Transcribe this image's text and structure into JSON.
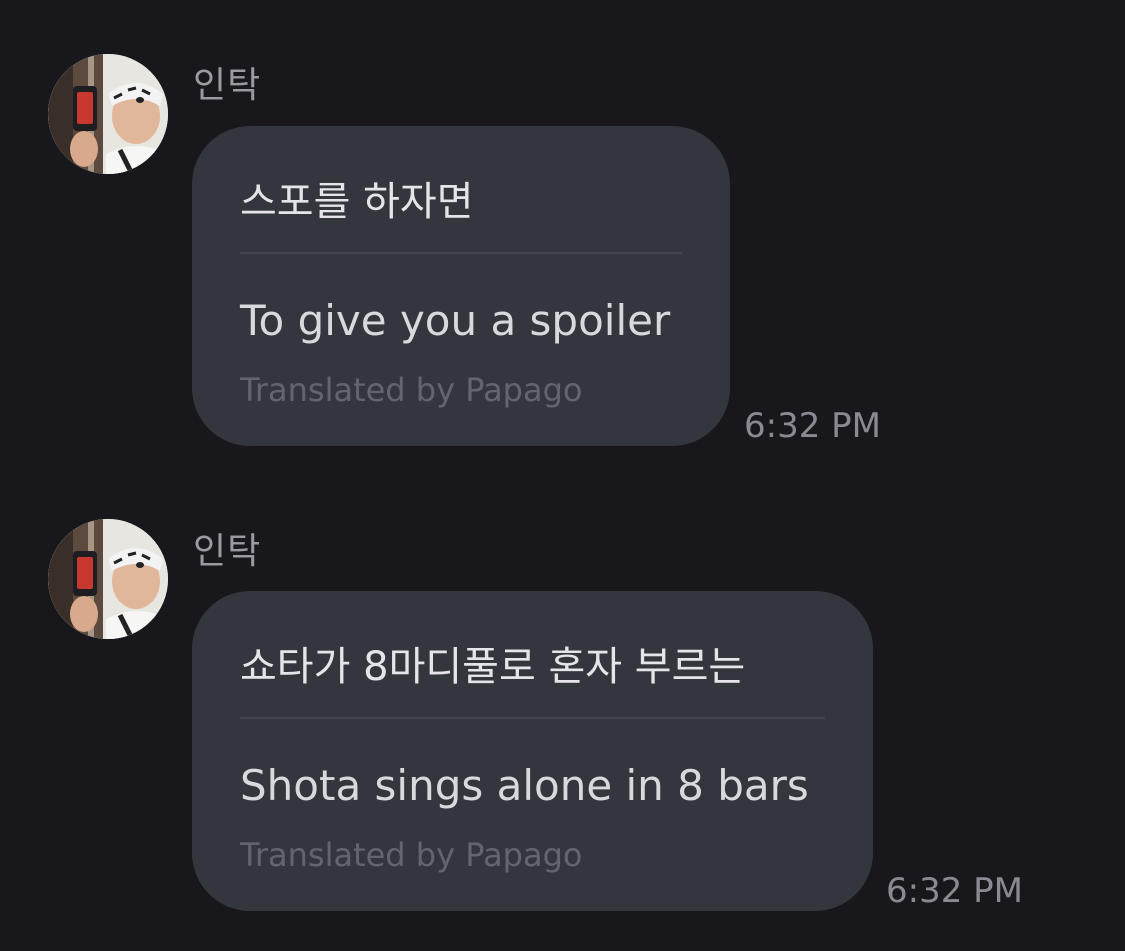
{
  "messages": [
    {
      "sender": "인탁",
      "avatar_icon": "profile-photo-avatar",
      "original": "스포를 하자면",
      "translated": "To give you a spoiler",
      "credit": "Translated by Papago",
      "time": "6:32 PM"
    },
    {
      "sender": "인탁",
      "avatar_icon": "profile-photo-avatar",
      "original": "쇼타가 8마디풀로 혼자 부르는",
      "translated": "Shota sings alone in 8 bars",
      "credit": "Translated by Papago",
      "time": "6:32 PM"
    }
  ],
  "colors": {
    "background": "#17171c",
    "bubble": "#34363e",
    "text": "#e4e4ea",
    "muted": "#8a8a93"
  }
}
